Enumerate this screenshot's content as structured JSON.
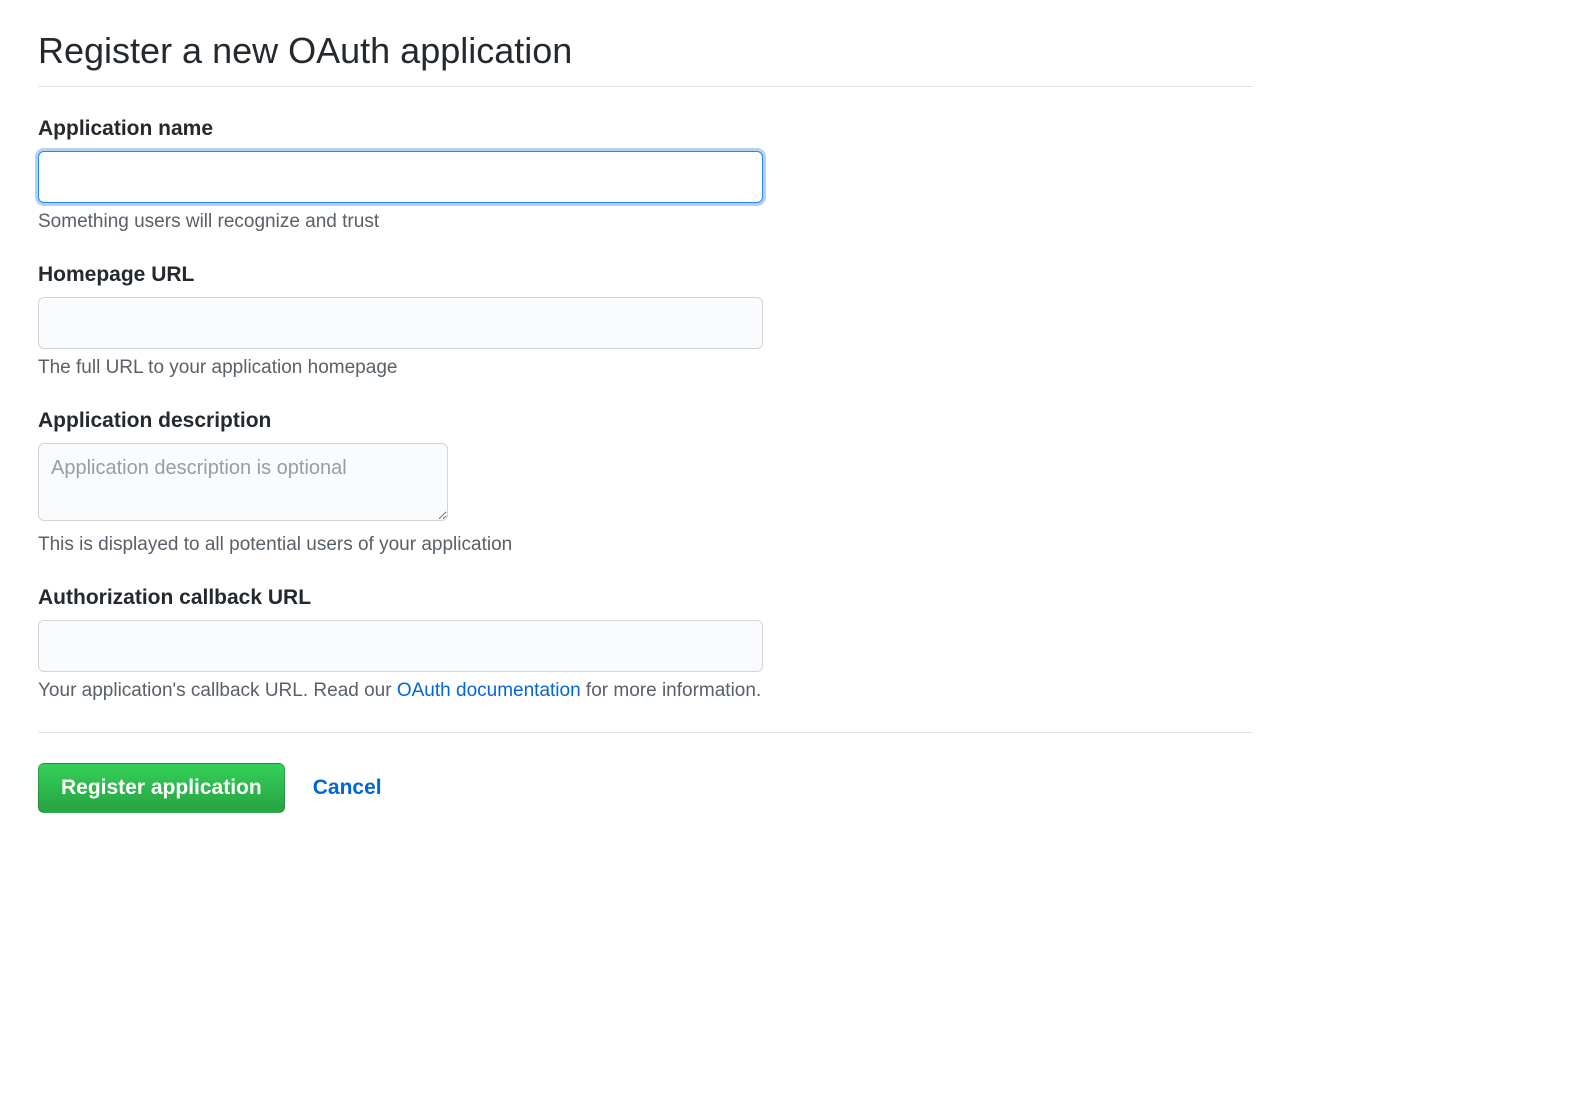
{
  "page": {
    "title": "Register a new OAuth application"
  },
  "form": {
    "app_name": {
      "label": "Application name",
      "value": "",
      "help": "Something users will recognize and trust"
    },
    "homepage_url": {
      "label": "Homepage URL",
      "value": "",
      "help": "The full URL to your application homepage"
    },
    "description": {
      "label": "Application description",
      "value": "",
      "placeholder": "Application description is optional",
      "help": "This is displayed to all potential users of your application"
    },
    "callback_url": {
      "label": "Authorization callback URL",
      "value": "",
      "help_prefix": "Your application's callback URL. Read our ",
      "help_link_text": "OAuth documentation",
      "help_suffix": " for more information."
    }
  },
  "actions": {
    "submit_label": "Register application",
    "cancel_label": "Cancel"
  }
}
